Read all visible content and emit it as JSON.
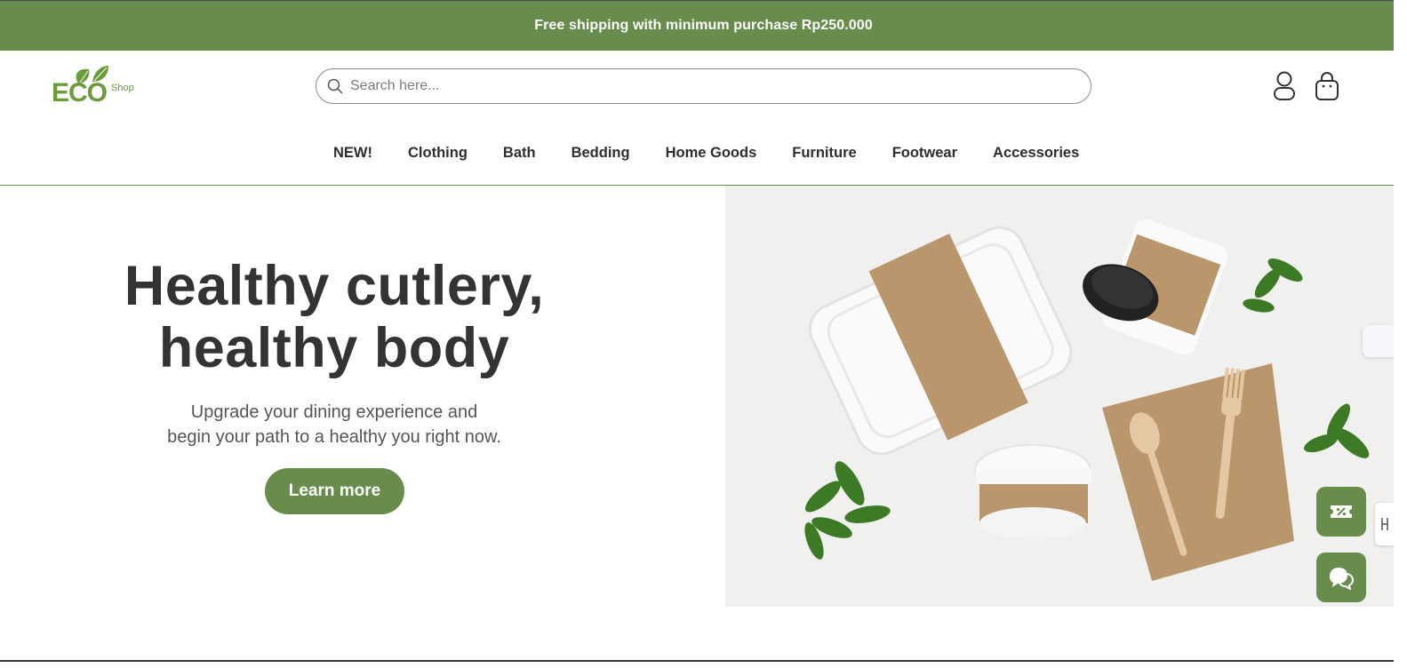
{
  "announcement": {
    "text": "Free shipping with minimum purchase Rp250.000"
  },
  "brand": {
    "logo_main": "ECO",
    "logo_sub": "Shop"
  },
  "search": {
    "placeholder": "Search here...",
    "value": ""
  },
  "header_icons": {
    "account": "user-icon",
    "cart": "shopping-bag-icon"
  },
  "nav": {
    "items": [
      {
        "label": "NEW!"
      },
      {
        "label": "Clothing"
      },
      {
        "label": "Bath"
      },
      {
        "label": "Bedding"
      },
      {
        "label": "Home Goods"
      },
      {
        "label": "Furniture"
      },
      {
        "label": "Footwear"
      },
      {
        "label": "Accessories"
      }
    ]
  },
  "hero": {
    "title_line1": "Healthy cutlery,",
    "title_line2": "healthy body",
    "subtitle_line1": "Upgrade your dining experience and",
    "subtitle_line2": "begin your path to a healthy you right now.",
    "cta_label": "Learn more",
    "image": "eco-friendly-tableware-photo"
  },
  "floating": {
    "coupon": "coupon-icon",
    "chat": "chat-icon"
  },
  "colors": {
    "brand_green": "#688c4c",
    "logo_green": "#6b9b3a",
    "text_dark": "#333333",
    "text_muted": "#555555"
  }
}
